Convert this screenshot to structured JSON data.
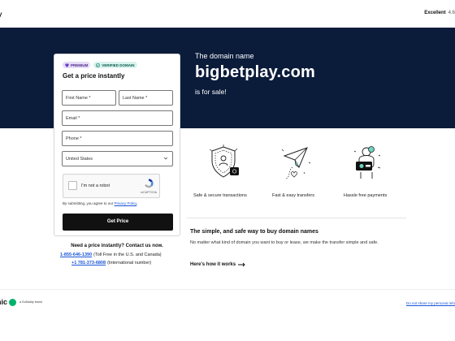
{
  "topbar": {
    "logo_text": "y",
    "rating_label": "Excellent",
    "rating_score": "4.6"
  },
  "hero": {
    "kicker": "The domain name",
    "domain": "bigbetplay.com",
    "forsale": "is for sale!"
  },
  "form": {
    "badge_premium": "PREMIUM",
    "badge_verified": "VERIFIED DOMAIN",
    "title": "Get a price instantly",
    "first_name_placeholder": "First Name *",
    "last_name_placeholder": "Last Name *",
    "email_placeholder": "Email *",
    "phone_placeholder": "Phone *",
    "country_value": "United States",
    "recaptcha_label": "I'm not a robot",
    "recaptcha_brand": "reCAPTCHA",
    "consent_text": "By submitting, you agree to our ",
    "privacy_link": "Privacy Policy",
    "consent_end": ".",
    "submit_label": "Get Price"
  },
  "contact": {
    "title": "Need a price instantly? Contact us now.",
    "phone1": "1-855-646-1390",
    "phone1_note": "(Toll Free in the U.S. and Canada)",
    "phone2": "+1 781-373-6808",
    "phone2_note": "(International number)"
  },
  "features": [
    {
      "icon": "secure-transaction-icon",
      "label": "Safe & secure transactions"
    },
    {
      "icon": "fast-transfer-icon",
      "label": "Fast & easy transfers"
    },
    {
      "icon": "payment-icon",
      "label": "Hassle free payments"
    }
  ],
  "simple": {
    "title": "The simple, and safe way to buy domain names",
    "body": "No matter what kind of domain you want to buy or lease, we make the transfer simple and safe.",
    "link": "Here's how it works"
  },
  "footer": {
    "logo_text": "nic",
    "brand_note": "a GoDaddy brand",
    "link": "Do not share my personal info"
  },
  "colors": {
    "hero_bg": "#0b1c3a",
    "link": "#1a55d6",
    "button": "#111111"
  }
}
